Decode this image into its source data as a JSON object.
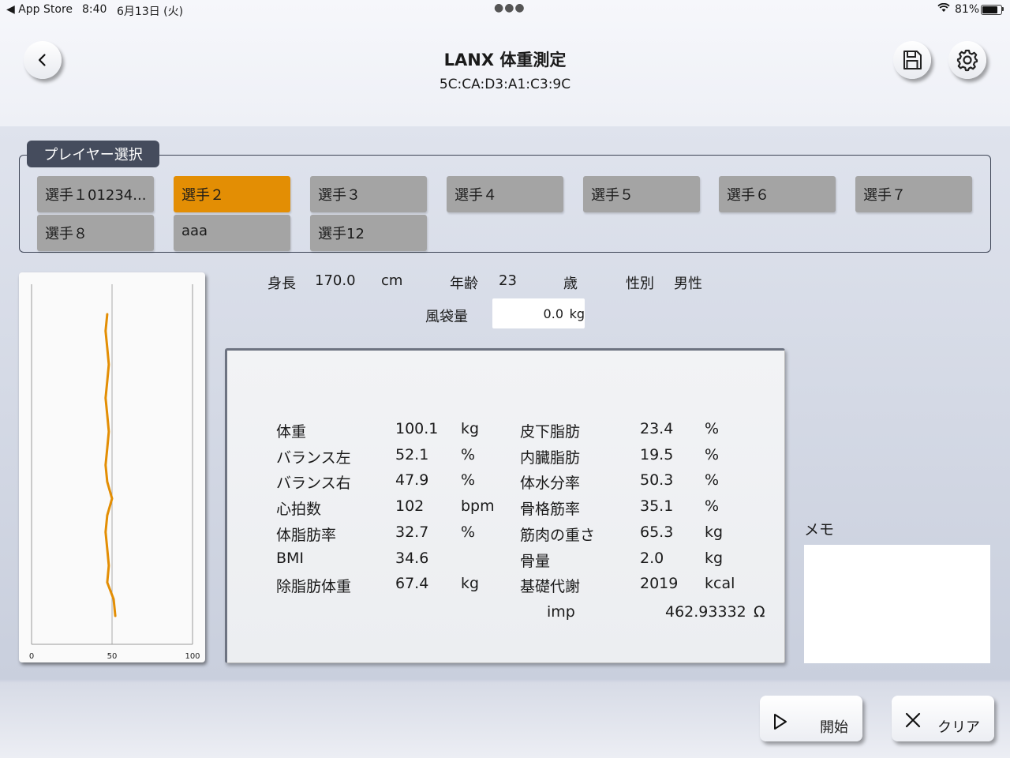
{
  "status_bar": {
    "back_app": "◀ App Store",
    "time": "8:40",
    "date": "6月13日 (火)",
    "battery": "81%",
    "battery_level": 0.81
  },
  "header": {
    "title": "LANX 体重測定",
    "subtitle": "5C:CA:D3:A1:C3:9C",
    "icons": [
      "chevron-left-icon",
      "save-icon",
      "gear-icon"
    ]
  },
  "players": {
    "label": "プレイヤー選択",
    "selected_index": 1,
    "items": [
      {
        "label": "選手１01234..."
      },
      {
        "label": "選手２"
      },
      {
        "label": "選手３"
      },
      {
        "label": "選手４"
      },
      {
        "label": "選手５"
      },
      {
        "label": "選手６"
      },
      {
        "label": "選手７"
      },
      {
        "label": "選手８"
      },
      {
        "label": "aaa"
      },
      {
        "label": "選手12"
      }
    ]
  },
  "profile": {
    "height_label": "身長",
    "height_value": "170.0",
    "height_unit": "cm",
    "age_label": "年齢",
    "age_value": "23",
    "age_unit": "歳",
    "sex_label": "性別",
    "sex_value": "男性",
    "balloon_label": "風袋量",
    "balloon_value": "0.0",
    "balloon_unit": "kg"
  },
  "results": {
    "left": [
      {
        "label": "体重",
        "value": "100.1",
        "unit": "kg"
      },
      {
        "label": "バランス左",
        "value": "52.1",
        "unit": "%"
      },
      {
        "label": "バランス右",
        "value": "47.9",
        "unit": "%"
      },
      {
        "label": "心拍数",
        "value": "102",
        "unit": "bpm"
      },
      {
        "label": "体脂肪率",
        "value": "32.7",
        "unit": "%"
      },
      {
        "label": "BMI",
        "value": "34.6",
        "unit": ""
      },
      {
        "label": "除脂肪体重",
        "value": "67.4",
        "unit": "kg"
      }
    ],
    "right": [
      {
        "label": "皮下脂肪",
        "value": "23.4",
        "unit": "%"
      },
      {
        "label": "内臓脂肪",
        "value": "19.5",
        "unit": "%"
      },
      {
        "label": "体水分率",
        "value": "50.3",
        "unit": "%"
      },
      {
        "label": "骨格筋率",
        "value": "35.1",
        "unit": "%"
      },
      {
        "label": "筋肉の重さ",
        "value": "65.3",
        "unit": "kg"
      },
      {
        "label": "骨量",
        "value": "2.0",
        "unit": "kg"
      },
      {
        "label": "基礎代謝",
        "value": "2019",
        "unit": "kcal"
      }
    ],
    "imp_label": "imp",
    "imp_value": "462.93332",
    "imp_unit": "Ω"
  },
  "chart_data": {
    "type": "line",
    "title": "",
    "xlabel": "",
    "ylabel": "",
    "orientation": "vertical-trace",
    "xlim": [
      0,
      100
    ],
    "x_ticks": [
      "0",
      "50",
      "100"
    ],
    "values": [
      47,
      46,
      47,
      48,
      47,
      46,
      47,
      48,
      47,
      46,
      47,
      50,
      47,
      46,
      47,
      48,
      47,
      51,
      52
    ],
    "color": "#e38e04"
  },
  "memo": {
    "label": "メモ",
    "value": ""
  },
  "footer": {
    "start_label": "開始",
    "clear_label": "クリア"
  }
}
